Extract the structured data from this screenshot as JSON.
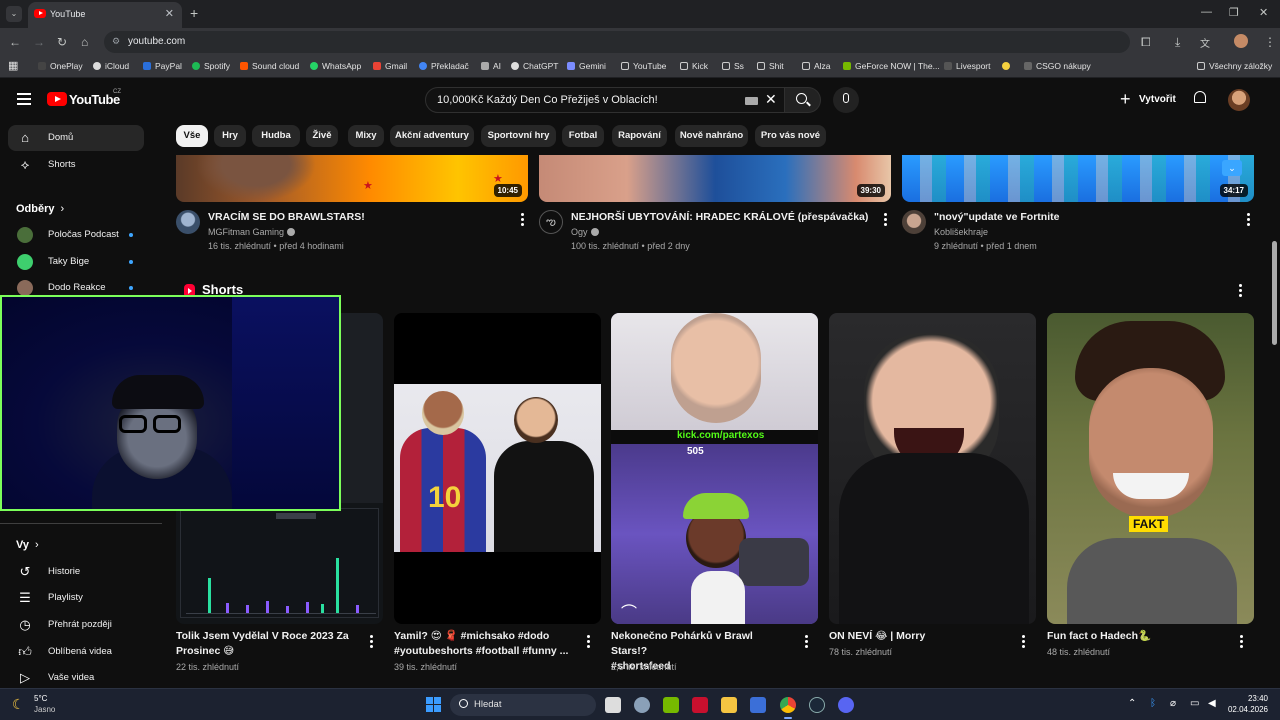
{
  "browser": {
    "tab_title": "YouTube",
    "url": "youtube.com",
    "bookmarks": [
      "OnePlay",
      "iCloud",
      "PayPal",
      "Spotify",
      "Sound cloud",
      "WhatsApp",
      "Gmail",
      "Překladač",
      "AI",
      "ChatGPT",
      "Gemini",
      "YouTube",
      "Kick",
      "Ss",
      "Shit",
      "Alza",
      "GeForce NOW | The...",
      "Livesport",
      "CSGO nákupy"
    ],
    "all_bookmarks": "Všechny záložky"
  },
  "header": {
    "logo_text": "YouTube",
    "country": "CZ",
    "search_query": "10,000Kč Každý Den Co Přežiješ v Oblacích!",
    "create_label": "Vytvořit"
  },
  "sidebar": {
    "home": "Domů",
    "shorts": "Shorts",
    "subscriptions_heading": "Odběry",
    "subscriptions": [
      "Poločas Podcast",
      "Taky Bige",
      "Dodo Reakce"
    ],
    "you_heading": "Vy",
    "you_items": [
      "Historie",
      "Playlisty",
      "Přehrát později",
      "Oblíbená videa",
      "Vaše videa"
    ]
  },
  "chips": [
    "Vše",
    "Hry",
    "Hudba",
    "Živě",
    "Mixy",
    "Akční adventury",
    "Sportovní hry",
    "Fotbal",
    "Rapování",
    "Nově nahráno",
    "Pro vás nové"
  ],
  "videos": [
    {
      "title": "VRACÍM SE DO BRAWLSTARS!",
      "channel": "MGFitman Gaming",
      "meta": "16 tis. zhlédnutí • před 4 hodinami",
      "duration": "10:45"
    },
    {
      "title": "NEJHORŠÍ UBYTOVÁNÍ: HRADEC KRÁLOVÉ (přespávačka)",
      "channel": "Ogy",
      "meta": "100 tis. zhlédnutí • před 2 dny",
      "duration": "39:30"
    },
    {
      "title": "\"nový\"update ve Fortnite",
      "channel": "Koblišekhraje",
      "meta": "9 zhlédnutí • před 1 dnem",
      "duration": "34:17"
    }
  ],
  "shorts": {
    "heading": "Shorts",
    "items": [
      {
        "title_line1": "Tolik Jsem Vydělal V Roce 2023 Za",
        "title_line2": "Prosinec 😅",
        "views": "22 tis. zhlédnutí"
      },
      {
        "title_line1": "Yamil? 😍 🧣 #michsako #dodo",
        "title_line2": "#youtubeshorts #football #funny ...",
        "views": "39 tis. zhlédnutí"
      },
      {
        "title_line1": "Nekonečno Pohárků v Brawl Stars!?",
        "title_line2": "#shortsfeed",
        "views": "2,6 tis. zhlédnutí"
      },
      {
        "title_line1": "ON NEVÍ 😂 | Morry",
        "title_line2": "",
        "views": "78 tis. zhlédnutí"
      },
      {
        "title_line1": "Fun fact o Hadech🐍",
        "title_line2": "",
        "views": "48 tis. zhlédnutí"
      }
    ],
    "overlay_texts": {
      "kick": "kick.com/partexos",
      "trophy": "505",
      "fakt": "FAKT",
      "jersey": "10"
    }
  },
  "taskbar": {
    "weather_temp": "5°C",
    "weather_desc": "Jasno",
    "search_label": "Hledat",
    "time": "23:40",
    "date": "02.04.2026"
  }
}
